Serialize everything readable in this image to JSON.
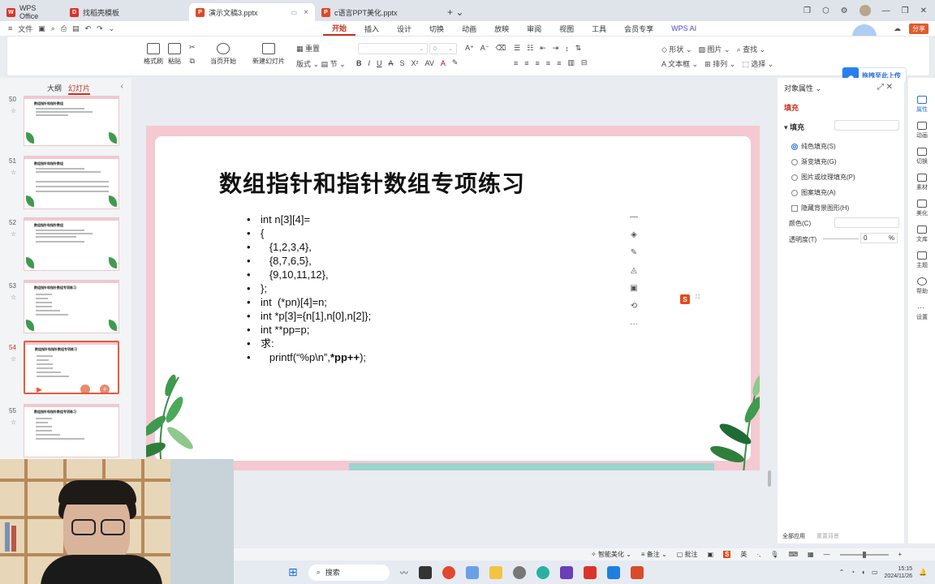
{
  "tabs": [
    {
      "label": "WPS Office",
      "icon_color": "#d9342b",
      "icon_letter": "W"
    },
    {
      "label": "找稻壳模板",
      "icon_color": "#d9342b",
      "icon_letter": "D"
    },
    {
      "label": "演示文稿3.pptx",
      "icon_color": "#d94b2b",
      "icon_letter": "P"
    },
    {
      "label": "c语言PPT美化.pptx",
      "icon_color": "#d94b2b",
      "icon_letter": "P"
    }
  ],
  "menu": {
    "file": "文件",
    "tabs": [
      "开始",
      "插入",
      "设计",
      "切换",
      "动画",
      "放映",
      "审阅",
      "视图",
      "工具",
      "会员专享",
      "WPS AI"
    ],
    "active_tab": "开始",
    "share": "分享"
  },
  "ribbon": {
    "format_painter": "格式刷",
    "paste": "粘贴",
    "play_from_current": "当页开始",
    "new_slide": "新建幻灯片",
    "layout": "版式",
    "section": "节",
    "reset": "重置",
    "font_size_placeholder": "0",
    "shape": "形状",
    "picture": "图片",
    "find": "查找",
    "textbox": "文本框",
    "arrange": "排列",
    "select": "选择"
  },
  "wps_ai_float": "拖拽至此上传",
  "left_panel": {
    "tab_outline": "大纲",
    "tab_slides": "幻灯片",
    "thumbnails": [
      {
        "num": "50",
        "title": "数组指针和指针数组",
        "selected": false
      },
      {
        "num": "51",
        "title": "数组指针和指针数组",
        "selected": false
      },
      {
        "num": "52",
        "title": "数组指针和指针数组",
        "selected": false
      },
      {
        "num": "53",
        "title": "数组指针和指针数组专项练习",
        "selected": false
      },
      {
        "num": "54",
        "title": "数组指针和指针数组专项练习",
        "selected": true
      },
      {
        "num": "55",
        "title": "数组指针和指针数组专项练习",
        "selected": false
      }
    ]
  },
  "slide": {
    "title": "数组指针和指针数组专项练习",
    "bullets": [
      "int n[3][4]=",
      "{",
      "   {1,2,3,4},",
      "   {8,7,6,5},",
      "   {9,10,11,12},",
      "};",
      "int  (*pn)[4]=n;",
      "int *p[3]={n[1],n[0],n[2]};",
      "int **pp=p;",
      "求:"
    ],
    "last_bullet_prefix": "   printf(“%p\\n”,",
    "last_bullet_bold": "*pp++",
    "last_bullet_suffix": ");"
  },
  "right_panel": {
    "title": "对象属性",
    "tab_fill": "填充",
    "section_fill": "填充",
    "options": [
      "纯色填充(S)",
      "渐变填充(G)",
      "图片或纹理填充(P)",
      "图案填充(A)"
    ],
    "selected_option": 0,
    "hide_bg": "隐藏背景图形(H)",
    "color_label": "颜色(C)",
    "transparency_label": "透明度(T)",
    "transparency_value": "0",
    "transparency_unit": "%",
    "apply_all": "全部应用",
    "reset_bg": "重置背景"
  },
  "rail": [
    {
      "label": "属性",
      "active": true
    },
    {
      "label": "动画",
      "active": false
    },
    {
      "label": "切换",
      "active": false
    },
    {
      "label": "素材",
      "active": false
    },
    {
      "label": "美化",
      "active": false
    },
    {
      "label": "文库",
      "active": false
    },
    {
      "label": "主题",
      "active": false
    },
    {
      "label": "帮助",
      "active": false
    },
    {
      "label": "设置",
      "active": false
    }
  ],
  "status": {
    "smart_beautify": "智能美化",
    "notes": "备注",
    "comments": "批注",
    "ime": "英"
  },
  "taskbar": {
    "search": "搜索",
    "time": "15:15",
    "date": "2024/11/26"
  }
}
